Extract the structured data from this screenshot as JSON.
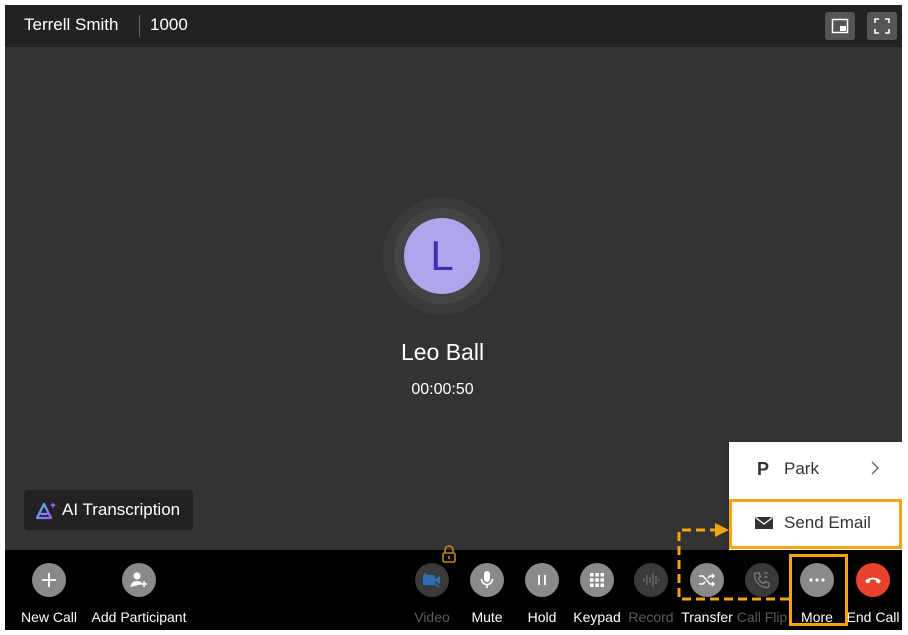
{
  "header": {
    "caller_name": "Terrell Smith",
    "extension": "1000",
    "icons": [
      "picture-in-picture-icon",
      "fullscreen-icon"
    ]
  },
  "call": {
    "avatar_letter": "L",
    "remote_name": "Leo Ball",
    "duration": "00:00:50"
  },
  "ai_transcription": {
    "label": "AI Transcription"
  },
  "toolbar": {
    "new_call": "New Call",
    "add_participant": "Add Participant",
    "video": "Video",
    "mute": "Mute",
    "hold": "Hold",
    "keypad": "Keypad",
    "record": "Record",
    "transfer": "Transfer",
    "call_flip": "Call Flip",
    "more": "More",
    "end_call": "End Call"
  },
  "more_menu": {
    "park": "Park",
    "send_email": "Send Email"
  },
  "colors": {
    "highlight": "#f5a50b",
    "end_call": "#e8412e",
    "avatar_bg": "#aea6ea",
    "avatar_text": "#3a2fae"
  }
}
